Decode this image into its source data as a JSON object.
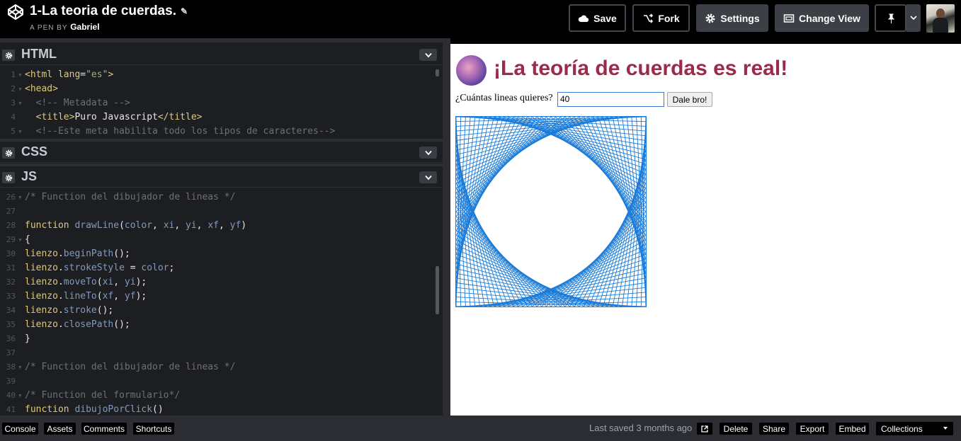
{
  "header": {
    "pen_title": "1-La teoria de cuerdas.",
    "pen_by_prefix": "A PEN BY",
    "author": "Gabriel",
    "save_label": "Save",
    "fork_label": "Fork",
    "settings_label": "Settings",
    "change_view_label": "Change View"
  },
  "editors": {
    "html": {
      "title": "HTML",
      "lines": [
        {
          "n": "1",
          "fold": true
        },
        {
          "n": "2",
          "fold": true
        },
        {
          "n": "3",
          "fold": true
        },
        {
          "n": "4",
          "fold": false
        },
        {
          "n": "5",
          "fold": true
        }
      ],
      "code": [
        [
          "tag",
          "<html "
        ],
        [
          "attr",
          "lang"
        ],
        [
          "txt",
          "="
        ],
        [
          "str",
          "\"es\""
        ],
        [
          "tag",
          ">"
        ]
      ]
    },
    "css": {
      "title": "CSS"
    },
    "js": {
      "title": "JS",
      "line_numbers": [
        "26",
        "27",
        "28",
        "29",
        "30",
        "31",
        "32",
        "33",
        "34",
        "35",
        "36",
        "37",
        "38",
        "39",
        "40",
        "41"
      ],
      "folds": [
        true,
        false,
        false,
        true,
        false,
        false,
        false,
        false,
        false,
        false,
        false,
        false,
        true,
        false,
        true,
        false
      ]
    }
  },
  "html_code": {
    "l1_open": "<html ",
    "l1_attr": "lang",
    "l1_eq": "=",
    "l1_val": "\"es\"",
    "l1_close": ">",
    "l2": "<head>",
    "l3": "  <!-- Metadata -->",
    "l4_open": "  <title>",
    "l4_text": "Puro Javascript",
    "l4_close": "</title>",
    "l5": "  <!--Este meta habilita todo los tipos de caracteres-->"
  },
  "js_code": {
    "c26": "/* Function del dibujador de lineas */",
    "c28_kw": "function ",
    "c28_fn": "drawLine",
    "c28_open": "(",
    "c28_p1": "color",
    "c28_c1": ", ",
    "c28_p2": "xi",
    "c28_c2": ", ",
    "c28_p3": "yi",
    "c28_c3": ", ",
    "c28_p4": "xf",
    "c28_c4": ", ",
    "c28_p5": "yf",
    "c28_close": ")",
    "c29": "{",
    "c30_obj": "lienzo",
    "c30_dot": ".",
    "c30_m": "beginPath",
    "c30_end": "();",
    "c31_obj": "lienzo",
    "c31_dot": ".",
    "c31_m": "strokeStyle",
    "c31_eq": " = ",
    "c31_v": "color",
    "c31_end": ";",
    "c32_obj": "lienzo",
    "c32_dot": ".",
    "c32_m": "moveTo",
    "c32_o": "(",
    "c32_a": "xi",
    "c32_c": ", ",
    "c32_b": "yi",
    "c32_end": ");",
    "c33_obj": "lienzo",
    "c33_dot": ".",
    "c33_m": "lineTo",
    "c33_o": "(",
    "c33_a": "xf",
    "c33_c": ", ",
    "c33_b": "yf",
    "c33_end": ");",
    "c34_obj": "lienzo",
    "c34_dot": ".",
    "c34_m": "stroke",
    "c34_end": "();",
    "c35_obj": "lienzo",
    "c35_dot": ".",
    "c35_m": "closePath",
    "c35_end": "();",
    "c36": "}",
    "c38": "/* Function del dibujador de lineas */",
    "c40": "/* Function del formulario*/",
    "c41_kw": "function ",
    "c41_fn": "dibujoPorClick",
    "c41_end": "()"
  },
  "preview": {
    "title": "¡La teoría de cuerdas es real!",
    "question_label": "¿Cuántas lineas quieres?",
    "input_value": "40",
    "button_label": "Dale bro!",
    "line_color": "#1a7bd8",
    "lines_count": 40
  },
  "footer": {
    "console": "Console",
    "assets": "Assets",
    "comments": "Comments",
    "shortcuts": "Shortcuts",
    "last_saved": "Last saved 3 months ago",
    "delete": "Delete",
    "share": "Share",
    "export": "Export",
    "embed": "Embed",
    "collections": "Collections"
  },
  "icons": {
    "logo": "codepen-logo-icon",
    "edit": "pencil-icon",
    "save": "cloud-icon",
    "fork": "fork-icon",
    "settings": "gear-icon",
    "change_view": "layout-icon",
    "pin": "pin-icon",
    "external": "external-link-icon"
  }
}
